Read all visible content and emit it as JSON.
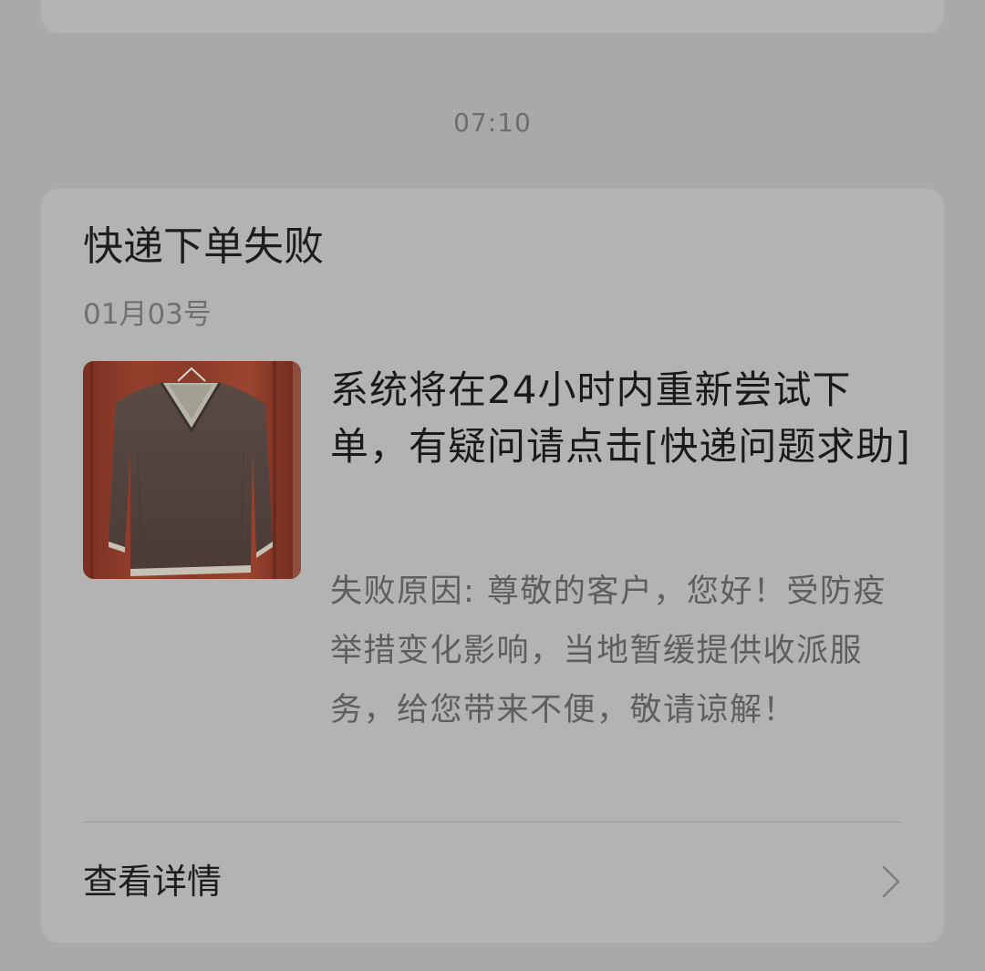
{
  "timestamp": "07:10",
  "notification": {
    "title": "快递下单失败",
    "date": "01月03号",
    "thumbnail": {
      "icon": "sweater-photo"
    },
    "message": "系统将在24小时内重新尝试下单，有疑问请点击[快递问题求助]",
    "reason": "失败原因: 尊敬的客户，您好！受防疫举措变化影响，当地暂缓提供收派服务，给您带来不便，敬请谅解！",
    "details_label": "查看详情"
  },
  "colors": {
    "background": "#a9a9a9",
    "card": "#b3b3b3",
    "title_text": "#1d1d1d",
    "secondary_text": "#707070"
  }
}
